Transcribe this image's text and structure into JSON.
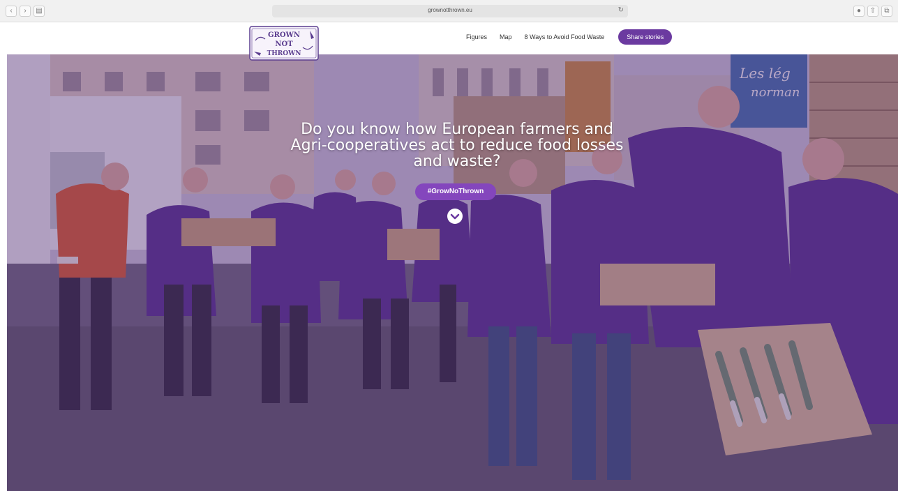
{
  "browser": {
    "url": "grownotthrown.eu",
    "reload_glyph": "↻"
  },
  "logo": {
    "line1": "GROWN",
    "line2": "NOT",
    "line3": "THROWN",
    "accent_color": "#5b3d8f"
  },
  "nav": {
    "items": [
      "Figures",
      "Map",
      "8 Ways to Avoid Food Waste"
    ],
    "cta": "Share stories"
  },
  "hero": {
    "headline": "Do you know how European farmers and Agri-cooperatives act to reduce food losses and waste?",
    "hashtag": "#GrowNoThrown",
    "scroll_icon": "chevron-down-icon",
    "banner_text_1": "Les lég",
    "banner_text_2": "norman"
  },
  "colors": {
    "brand_purple": "#6b3aa0",
    "overlay": "#582d7d"
  }
}
